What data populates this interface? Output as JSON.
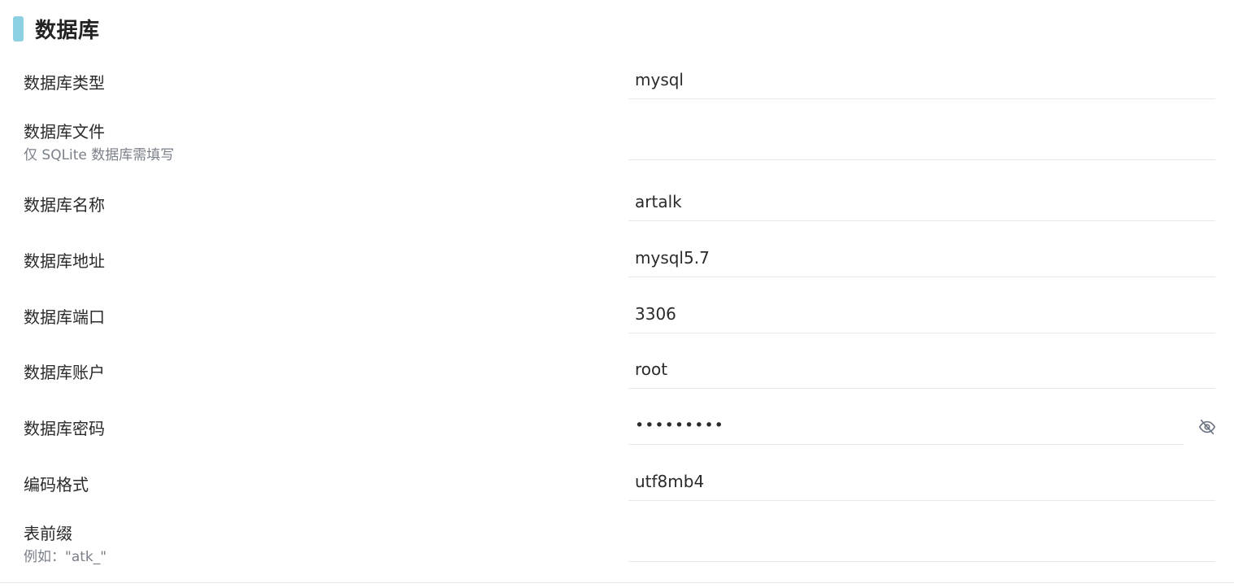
{
  "section": {
    "title": "数据库"
  },
  "fields": [
    {
      "label": "数据库类型",
      "hint": "",
      "value": "mysql"
    },
    {
      "label": "数据库文件",
      "hint": "仅 SQLite 数据库需填写",
      "value": ""
    },
    {
      "label": "数据库名称",
      "hint": "",
      "value": "artalk"
    },
    {
      "label": "数据库地址",
      "hint": "",
      "value": "mysql5.7"
    },
    {
      "label": "数据库端口",
      "hint": "",
      "value": "3306"
    },
    {
      "label": "数据库账户",
      "hint": "",
      "value": "root"
    },
    {
      "label": "数据库密码",
      "hint": "",
      "value": "•••••••••"
    },
    {
      "label": "编码格式",
      "hint": "",
      "value": "utf8mb4"
    },
    {
      "label": "表前缀",
      "hint": "例如：\"atk_\"",
      "value": ""
    }
  ],
  "icons": {
    "password_toggle": "eye-off-icon"
  },
  "colors": {
    "accent": "#8bd1e2",
    "hint_text": "#7a8089",
    "divider": "#e6e8eb"
  }
}
